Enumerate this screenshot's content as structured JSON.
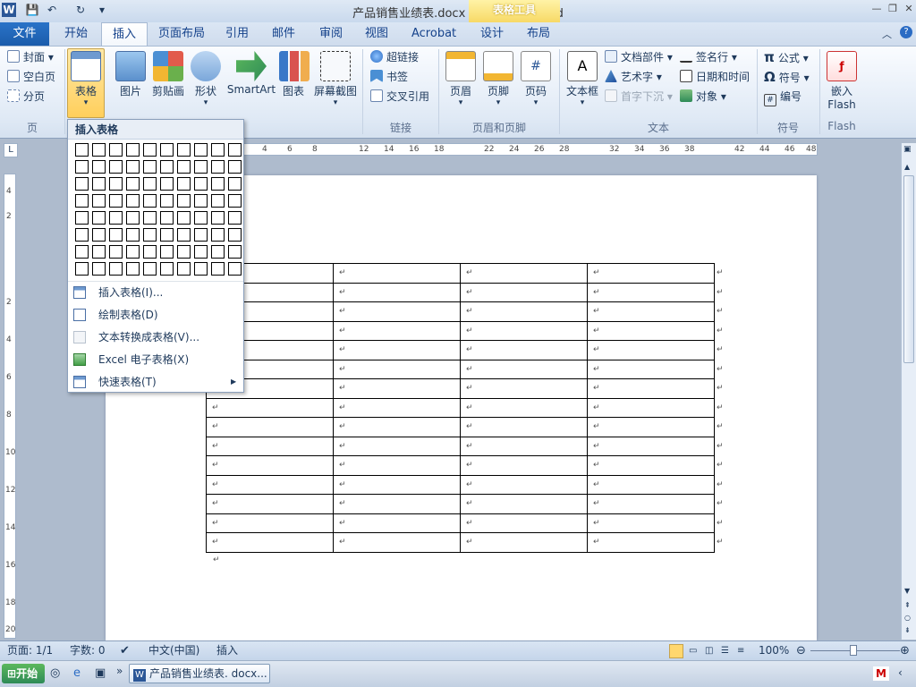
{
  "window": {
    "title": "产品销售业绩表.docx - Microsoft Word",
    "context_tab": "表格工具"
  },
  "tabs": [
    "文件",
    "开始",
    "插入",
    "页面布局",
    "引用",
    "邮件",
    "审阅",
    "视图",
    "Acrobat",
    "设计",
    "布局"
  ],
  "ribbon": {
    "page_group": {
      "items": [
        "封面",
        "空白页",
        "分页"
      ],
      "label": "页"
    },
    "table_button": "表格",
    "illustrations": [
      "图片",
      "剪贴画",
      "形状",
      "SmartArt",
      "图表",
      "屏幕截图"
    ],
    "links_group": {
      "items": [
        "超链接",
        "书签",
        "交叉引用"
      ],
      "label": "链接"
    },
    "header_footer": {
      "items": [
        "页眉",
        "页脚",
        "页码"
      ],
      "label": "页眉和页脚"
    },
    "text_group": {
      "textbox": "文本框",
      "items": [
        "文档部件",
        "艺术字",
        "首字下沉",
        "签名行",
        "日期和时间",
        "对象"
      ],
      "label": "文本"
    },
    "symbols_group": {
      "items": [
        "公式",
        "符号",
        "编号"
      ],
      "label": "符号"
    },
    "flash_group": {
      "button_line1": "嵌入",
      "button_line2": "Flash",
      "label": "Flash"
    }
  },
  "dropdown": {
    "title": "插入表格",
    "grid_cols": 10,
    "grid_rows": 8,
    "items": [
      {
        "label": "插入表格(I)...",
        "enabled": true
      },
      {
        "label": "绘制表格(D)",
        "enabled": true
      },
      {
        "label": "文本转换成表格(V)...",
        "enabled": false
      },
      {
        "label": "Excel 电子表格(X)",
        "enabled": true
      },
      {
        "label": "快速表格(T)",
        "enabled": true
      }
    ]
  },
  "ruler_h": [
    "4",
    "6",
    "8",
    "12",
    "14",
    "16",
    "18",
    "22",
    "24",
    "26",
    "28",
    "32",
    "34",
    "36",
    "38",
    "42",
    "44",
    "46",
    "48"
  ],
  "ruler_v": [
    "4",
    "2",
    "2",
    "4",
    "6",
    "8",
    "10",
    "12",
    "14",
    "16",
    "18",
    "20"
  ],
  "document": {
    "table_rows": 15,
    "table_cols": 4,
    "cell_mark": "↵"
  },
  "statusbar": {
    "page": "页面: 1/1",
    "words": "字数: 0",
    "language": "中文(中国)",
    "mode": "插入",
    "zoom": "100%"
  },
  "taskbar": {
    "start": "开始",
    "task": "产品销售业绩表. docx..."
  },
  "colors": {
    "file_tab": "#1b5cab",
    "context": "#f7d966"
  }
}
